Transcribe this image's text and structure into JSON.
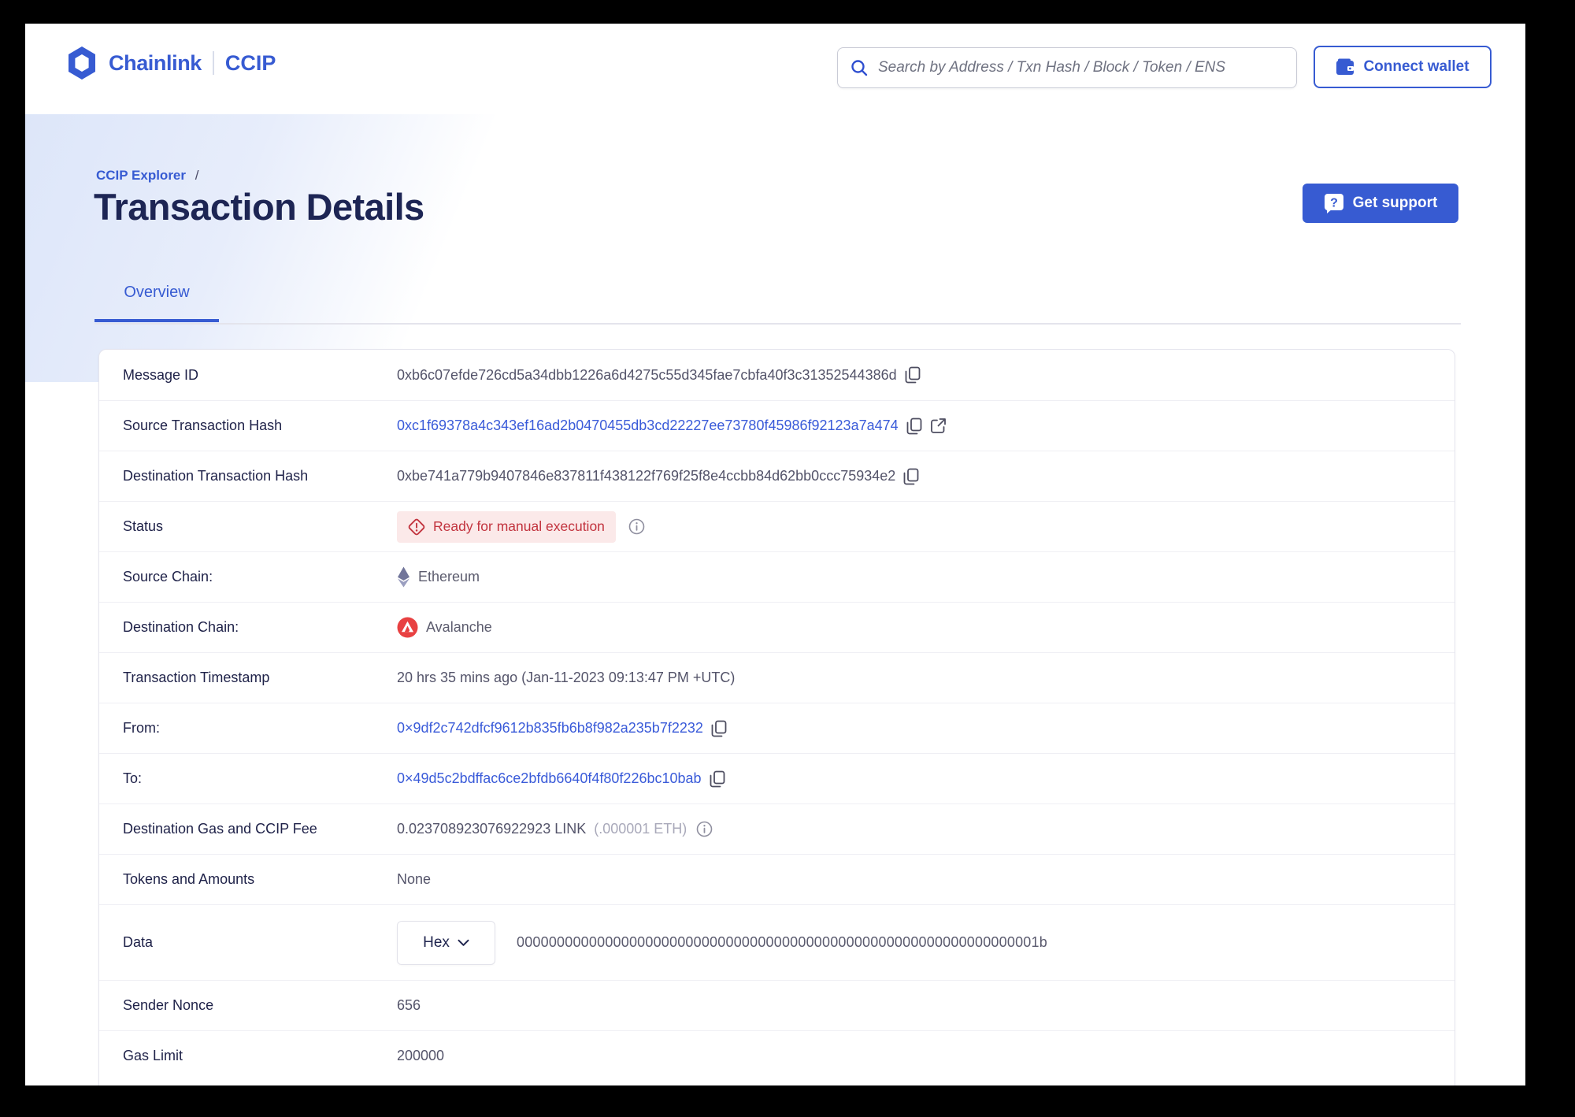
{
  "header": {
    "brand": {
      "name": "Chainlink",
      "product": "CCIP",
      "logo_icon": "chainlink-hexagon-icon"
    },
    "search": {
      "placeholder": "Search by Address / Txn Hash / Block / Token / ENS",
      "icon": "search-icon"
    },
    "connect_wallet": {
      "label": "Connect wallet",
      "icon": "wallet-icon"
    }
  },
  "page": {
    "breadcrumb": {
      "label": "CCIP Explorer",
      "separator": "/"
    },
    "title": "Transaction Details",
    "support_button": {
      "label": "Get support",
      "icon": "question-bubble-icon"
    },
    "tabs": [
      {
        "label": "Overview",
        "active": true
      }
    ]
  },
  "colors": {
    "brand_blue": "#375BD2",
    "navy_text": "#1e2148",
    "value_gray": "#54546a",
    "link_blue": "#3a5bd9",
    "status_red": "#c2333e",
    "status_bg": "#fbe9e9",
    "avalanche_red": "#e84142",
    "ethereum_gray": "#71759a"
  },
  "details": {
    "rows": [
      {
        "label": "Message ID",
        "type": "text-copy",
        "value": "0xb6c07efde726cd5a34dbb1226a6d4275c55d345fae7cbfa40f3c31352544386d",
        "icons": [
          "copy-icon"
        ]
      },
      {
        "label": "Source Transaction Hash",
        "type": "link-copy-external",
        "value": "0xc1f69378a4c343ef16ad2b0470455db3cd22227ee73780f45986f92123a7a474",
        "icons": [
          "copy-icon",
          "external-link-icon"
        ]
      },
      {
        "label": "Destination Transaction Hash",
        "type": "text-copy",
        "value": "0xbe741a779b9407846e837811f438122f769f25f8e4ccbb84d62bb0ccc75934e2",
        "icons": [
          "copy-icon"
        ]
      },
      {
        "label": "Status",
        "type": "status",
        "value": "Ready for manual execution",
        "icons": [
          "warning-diamond-icon",
          "info-icon"
        ]
      },
      {
        "label": "Source Chain:",
        "type": "chain",
        "chain": "ethereum",
        "value": "Ethereum",
        "icons": [
          "ethereum-icon"
        ]
      },
      {
        "label": "Destination Chain:",
        "type": "chain",
        "chain": "avalanche",
        "value": "Avalanche",
        "icons": [
          "avalanche-icon"
        ]
      },
      {
        "label": "Transaction Timestamp",
        "type": "text",
        "value": "20 hrs 35 mins ago (Jan-11-2023 09:13:47 PM +UTC)"
      },
      {
        "label": "From:",
        "type": "link-copy",
        "value": "0×9df2c742dfcf9612b835fb6b8f982a235b7f2232",
        "icons": [
          "copy-icon"
        ]
      },
      {
        "label": "To:",
        "type": "link-copy",
        "value": "0×49d5c2bdffac6ce2bfdb6640f4f80f226bc10bab",
        "icons": [
          "copy-icon"
        ]
      },
      {
        "label": "Destination Gas and CCIP Fee",
        "type": "fee",
        "value": "0.023708923076922923 LINK",
        "secondary": "(.000001 ETH)",
        "icons": [
          "info-icon"
        ]
      },
      {
        "label": "Tokens and Amounts",
        "type": "text",
        "value": "None"
      },
      {
        "label": "Data",
        "type": "data",
        "selector": "Hex",
        "selector_icon": "chevron-down-icon",
        "value": "00000000000000000000000000000000000000000000000000000000000000001b"
      },
      {
        "label": "Sender Nonce",
        "type": "text",
        "value": "656"
      },
      {
        "label": "Gas Limit",
        "type": "text",
        "value": "200000"
      }
    ]
  }
}
